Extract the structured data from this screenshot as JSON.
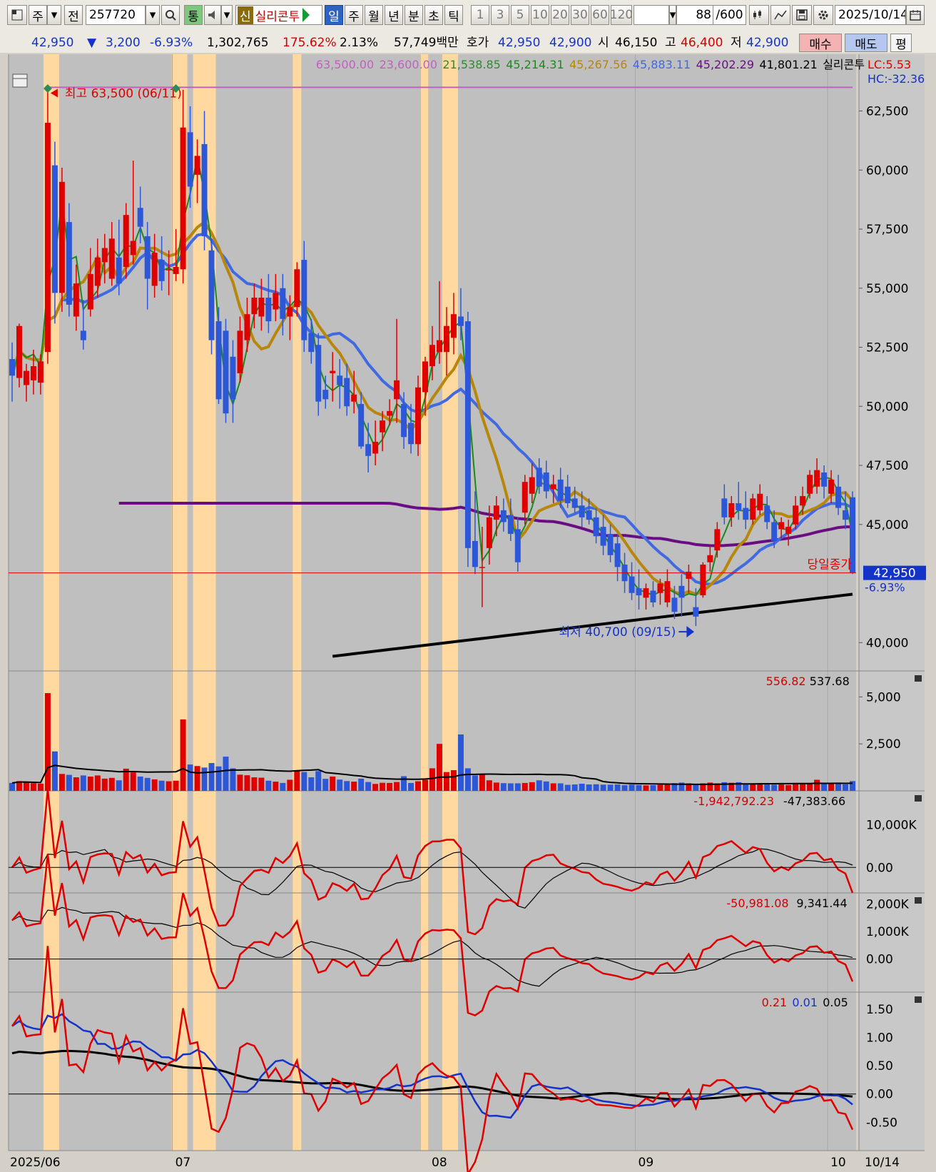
{
  "toolbar": {
    "market": "주",
    "prev": "전",
    "code": "257720",
    "tong": "통",
    "sin": "신",
    "stock_name": "실리콘투",
    "periods": [
      "일",
      "주",
      "월",
      "년",
      "분",
      "초",
      "틱"
    ],
    "intervals": [
      "1",
      "3",
      "5",
      "10",
      "20",
      "30",
      "60",
      "120"
    ],
    "count": "88",
    "count_max": "/600",
    "date": "2025/10/14"
  },
  "quote": {
    "price": "42,950",
    "change": "3,200",
    "change_pct": "-6.93%",
    "volume": "1,302,765",
    "vol_ratio": "175.62%",
    "turnover": "2.13%",
    "amount": "57,749백만",
    "hoga_label": "호가",
    "ask": "42,950",
    "bid": "42,900",
    "open_label": "시",
    "open": "46,150",
    "high_label": "고",
    "high": "46,400",
    "low_label": "저",
    "low": "42,900",
    "buy": "매수",
    "sell": "매도",
    "eval": "평"
  },
  "price_panel": {
    "legend": [
      {
        "text": "63,500.00",
        "color": "#c060c0"
      },
      {
        "text": "23,600.00",
        "color": "#c060c0"
      },
      {
        "text": "21,538.85",
        "color": "#2e8b2e"
      },
      {
        "text": "45,214.31",
        "color": "#1a8a1a"
      },
      {
        "text": "45,267.56",
        "color": "#b8860b"
      },
      {
        "text": "45,883.11",
        "color": "#4169e1"
      },
      {
        "text": "45,202.29",
        "color": "#6a0d83"
      },
      {
        "text": "41,801.21",
        "color": "#000000"
      },
      {
        "text": "실리콘투",
        "color": "#000000"
      }
    ],
    "lc": "LC:5.53",
    "hc": "HC:-32.36",
    "high_label": "최고 63,500 (06/11)",
    "low_label": "최저 40,700 (09/15)",
    "close_label": "당일종가",
    "last_price": "42,950",
    "last_pct": "-6.93%",
    "y_ticks": [
      "62,500",
      "60,000",
      "57,500",
      "55,000",
      "52,500",
      "50,000",
      "47,500",
      "45,000",
      "40,000"
    ]
  },
  "volume_panel": {
    "legend": [
      {
        "text": "556.82",
        "color": "#d40000"
      },
      {
        "text": "537.68",
        "color": "#000000"
      }
    ],
    "y_ticks": [
      "5,000",
      "2,500"
    ]
  },
  "ind1": {
    "legend": [
      {
        "text": "-1,942,792.23",
        "color": "#d40000"
      },
      {
        "text": "-47,383.66",
        "color": "#000000"
      }
    ],
    "y_ticks": [
      "10,000K",
      "0.00"
    ]
  },
  "ind2": {
    "legend": [
      {
        "text": "-50,981.08",
        "color": "#d40000"
      },
      {
        "text": "9,341.44",
        "color": "#000000"
      }
    ],
    "y_ticks": [
      "2,000K",
      "1,000K",
      "0.00"
    ]
  },
  "ind3": {
    "legend": [
      {
        "text": "0.21",
        "color": "#d40000"
      },
      {
        "text": "0.01",
        "color": "#1433c8"
      },
      {
        "text": "0.05",
        "color": "#000000"
      }
    ],
    "y_ticks": [
      "1.50",
      "1.00",
      "0.50",
      "0.00",
      "-0.50"
    ]
  },
  "x_labels": [
    "2025/06",
    "07",
    "08",
    "09",
    "10",
    "10/14"
  ],
  "candles": [
    {
      "o": 52000,
      "h": 52700,
      "l": 50200,
      "c": 51300,
      "v": 420
    },
    {
      "o": 51200,
      "h": 53500,
      "l": 50800,
      "c": 53400,
      "v": 520
    },
    {
      "o": 50900,
      "h": 51800,
      "l": 50200,
      "c": 51500,
      "v": 470
    },
    {
      "o": 51100,
      "h": 52400,
      "l": 50500,
      "c": 51700,
      "v": 410
    },
    {
      "o": 51000,
      "h": 52200,
      "l": 50500,
      "c": 51900,
      "v": 380
    },
    {
      "o": 52300,
      "h": 63500,
      "l": 51800,
      "c": 62000,
      "v": 5200
    },
    {
      "o": 60200,
      "h": 61200,
      "l": 53500,
      "c": 54800,
      "v": 2100
    },
    {
      "o": 54800,
      "h": 60100,
      "l": 54000,
      "c": 59500,
      "v": 900
    },
    {
      "o": 57800,
      "h": 58600,
      "l": 53800,
      "c": 54300,
      "v": 850
    },
    {
      "o": 53800,
      "h": 56000,
      "l": 53200,
      "c": 55200,
      "v": 720
    },
    {
      "o": 53200,
      "h": 54500,
      "l": 52400,
      "c": 52800,
      "v": 820
    },
    {
      "o": 54100,
      "h": 56700,
      "l": 53800,
      "c": 55600,
      "v": 760
    },
    {
      "o": 55100,
      "h": 57100,
      "l": 54600,
      "c": 56300,
      "v": 820
    },
    {
      "o": 56100,
      "h": 57300,
      "l": 55200,
      "c": 56700,
      "v": 650
    },
    {
      "o": 55400,
      "h": 57800,
      "l": 55100,
      "c": 57100,
      "v": 690
    },
    {
      "o": 56300,
      "h": 57900,
      "l": 54700,
      "c": 55200,
      "v": 560
    },
    {
      "o": 55900,
      "h": 58600,
      "l": 55400,
      "c": 58100,
      "v": 1180
    },
    {
      "o": 56400,
      "h": 60400,
      "l": 56000,
      "c": 57000,
      "v": 980
    },
    {
      "o": 58400,
      "h": 59300,
      "l": 56900,
      "c": 57600,
      "v": 760
    },
    {
      "o": 57200,
      "h": 57800,
      "l": 54100,
      "c": 55400,
      "v": 690
    },
    {
      "o": 55100,
      "h": 57300,
      "l": 54600,
      "c": 56500,
      "v": 610
    },
    {
      "o": 56200,
      "h": 57200,
      "l": 54900,
      "c": 55300,
      "v": 540
    },
    {
      "o": 55800,
      "h": 56600,
      "l": 54700,
      "c": 55800,
      "v": 510
    },
    {
      "o": 55600,
      "h": 57500,
      "l": 55300,
      "c": 55900,
      "v": 540
    },
    {
      "o": 55800,
      "h": 63400,
      "l": 55200,
      "c": 61800,
      "v": 3800
    },
    {
      "o": 61600,
      "h": 62700,
      "l": 58400,
      "c": 59300,
      "v": 1400
    },
    {
      "o": 59800,
      "h": 61300,
      "l": 58600,
      "c": 60600,
      "v": 1320
    },
    {
      "o": 61100,
      "h": 62500,
      "l": 56600,
      "c": 57200,
      "v": 1240
    },
    {
      "o": 56600,
      "h": 57100,
      "l": 52200,
      "c": 52800,
      "v": 1480
    },
    {
      "o": 53600,
      "h": 54200,
      "l": 50100,
      "c": 50300,
      "v": 1300
    },
    {
      "o": 53200,
      "h": 53700,
      "l": 49300,
      "c": 49700,
      "v": 1820
    },
    {
      "o": 52100,
      "h": 52800,
      "l": 49300,
      "c": 50300,
      "v": 1200
    },
    {
      "o": 51400,
      "h": 53800,
      "l": 51000,
      "c": 53200,
      "v": 860
    },
    {
      "o": 52800,
      "h": 54600,
      "l": 52300,
      "c": 53900,
      "v": 830
    },
    {
      "o": 53900,
      "h": 55200,
      "l": 53300,
      "c": 54600,
      "v": 720
    },
    {
      "o": 53800,
      "h": 55400,
      "l": 53200,
      "c": 54600,
      "v": 700
    },
    {
      "o": 54600,
      "h": 55600,
      "l": 53100,
      "c": 53600,
      "v": 540
    },
    {
      "o": 54100,
      "h": 55600,
      "l": 53600,
      "c": 54800,
      "v": 490
    },
    {
      "o": 55000,
      "h": 55600,
      "l": 53000,
      "c": 53700,
      "v": 420
    },
    {
      "o": 53800,
      "h": 54700,
      "l": 52800,
      "c": 54200,
      "v": 590
    },
    {
      "o": 54200,
      "h": 56100,
      "l": 53800,
      "c": 55800,
      "v": 1100
    },
    {
      "o": 56200,
      "h": 57000,
      "l": 52300,
      "c": 52800,
      "v": 1000
    },
    {
      "o": 53100,
      "h": 53700,
      "l": 51800,
      "c": 52300,
      "v": 720
    },
    {
      "o": 52600,
      "h": 53100,
      "l": 49600,
      "c": 50200,
      "v": 1050
    },
    {
      "o": 50700,
      "h": 51300,
      "l": 49900,
      "c": 50300,
      "v": 640
    },
    {
      "o": 51400,
      "h": 52300,
      "l": 50200,
      "c": 51500,
      "v": 760
    },
    {
      "o": 51300,
      "h": 52000,
      "l": 49900,
      "c": 50900,
      "v": 600
    },
    {
      "o": 51200,
      "h": 51800,
      "l": 49600,
      "c": 50000,
      "v": 520
    },
    {
      "o": 50200,
      "h": 51500,
      "l": 49700,
      "c": 50500,
      "v": 490
    },
    {
      "o": 50100,
      "h": 50600,
      "l": 48200,
      "c": 48300,
      "v": 650
    },
    {
      "o": 48400,
      "h": 49300,
      "l": 47200,
      "c": 47900,
      "v": 470
    },
    {
      "o": 48000,
      "h": 49400,
      "l": 47500,
      "c": 48500,
      "v": 370
    },
    {
      "o": 48900,
      "h": 49800,
      "l": 48100,
      "c": 49400,
      "v": 430
    },
    {
      "o": 49600,
      "h": 50300,
      "l": 49200,
      "c": 49800,
      "v": 420
    },
    {
      "o": 50300,
      "h": 53700,
      "l": 49300,
      "c": 51100,
      "v": 470
    },
    {
      "o": 50100,
      "h": 50600,
      "l": 48200,
      "c": 48700,
      "v": 780
    },
    {
      "o": 49300,
      "h": 50100,
      "l": 48000,
      "c": 48400,
      "v": 420
    },
    {
      "o": 48400,
      "h": 51300,
      "l": 47900,
      "c": 50800,
      "v": 510
    },
    {
      "o": 50600,
      "h": 52100,
      "l": 49600,
      "c": 51900,
      "v": 590
    },
    {
      "o": 51700,
      "h": 53400,
      "l": 51100,
      "c": 52600,
      "v": 1200
    },
    {
      "o": 52300,
      "h": 55300,
      "l": 51800,
      "c": 52800,
      "v": 2500
    },
    {
      "o": 52300,
      "h": 54200,
      "l": 51300,
      "c": 53400,
      "v": 1000
    },
    {
      "o": 52900,
      "h": 54800,
      "l": 52200,
      "c": 53900,
      "v": 1100
    },
    {
      "o": 53800,
      "h": 55000,
      "l": 52800,
      "c": 53400,
      "v": 3000
    },
    {
      "o": 53600,
      "h": 54000,
      "l": 43200,
      "c": 44000,
      "v": 1200
    },
    {
      "o": 44300,
      "h": 46400,
      "l": 42900,
      "c": 43200,
      "v": 820
    },
    {
      "o": 43200,
      "h": 44900,
      "l": 41500,
      "c": 43200,
      "v": 860
    },
    {
      "o": 44000,
      "h": 45800,
      "l": 43300,
      "c": 45300,
      "v": 560
    },
    {
      "o": 45200,
      "h": 46200,
      "l": 44500,
      "c": 45800,
      "v": 440
    },
    {
      "o": 45600,
      "h": 46100,
      "l": 44700,
      "c": 45100,
      "v": 410
    },
    {
      "o": 45400,
      "h": 46100,
      "l": 44300,
      "c": 44600,
      "v": 400
    },
    {
      "o": 44800,
      "h": 45300,
      "l": 43000,
      "c": 43400,
      "v": 400
    },
    {
      "o": 45500,
      "h": 47100,
      "l": 45000,
      "c": 46800,
      "v": 420
    },
    {
      "o": 46300,
      "h": 47600,
      "l": 45900,
      "c": 47000,
      "v": 460
    },
    {
      "o": 47400,
      "h": 47800,
      "l": 46300,
      "c": 46600,
      "v": 560
    },
    {
      "o": 47200,
      "h": 47700,
      "l": 46100,
      "c": 46400,
      "v": 500
    },
    {
      "o": 46500,
      "h": 47100,
      "l": 45900,
      "c": 46700,
      "v": 400
    },
    {
      "o": 46900,
      "h": 47400,
      "l": 45700,
      "c": 46000,
      "v": 400
    },
    {
      "o": 46600,
      "h": 47100,
      "l": 45700,
      "c": 45900,
      "v": 320
    },
    {
      "o": 46100,
      "h": 46600,
      "l": 45500,
      "c": 45700,
      "v": 340
    },
    {
      "o": 45800,
      "h": 46400,
      "l": 44900,
      "c": 45300,
      "v": 380
    },
    {
      "o": 45600,
      "h": 46100,
      "l": 45000,
      "c": 45200,
      "v": 340
    },
    {
      "o": 45300,
      "h": 45700,
      "l": 44200,
      "c": 44500,
      "v": 350
    },
    {
      "o": 44900,
      "h": 45400,
      "l": 43700,
      "c": 44100,
      "v": 330
    },
    {
      "o": 44600,
      "h": 45000,
      "l": 43400,
      "c": 43700,
      "v": 330
    },
    {
      "o": 44200,
      "h": 44600,
      "l": 42600,
      "c": 43200,
      "v": 340
    },
    {
      "o": 43300,
      "h": 43800,
      "l": 42100,
      "c": 42600,
      "v": 300
    },
    {
      "o": 42800,
      "h": 43400,
      "l": 41800,
      "c": 42100,
      "v": 330
    },
    {
      "o": 42300,
      "h": 43100,
      "l": 41400,
      "c": 42000,
      "v": 310
    },
    {
      "o": 41900,
      "h": 42500,
      "l": 41400,
      "c": 42300,
      "v": 290
    },
    {
      "o": 42200,
      "h": 42600,
      "l": 41500,
      "c": 41700,
      "v": 300
    },
    {
      "o": 42100,
      "h": 42700,
      "l": 41600,
      "c": 42500,
      "v": 320
    },
    {
      "o": 41700,
      "h": 43100,
      "l": 41500,
      "c": 42600,
      "v": 320
    },
    {
      "o": 41900,
      "h": 42400,
      "l": 41000,
      "c": 41300,
      "v": 410
    },
    {
      "o": 42400,
      "h": 42900,
      "l": 41100,
      "c": 41900,
      "v": 440
    },
    {
      "o": 42700,
      "h": 43300,
      "l": 42100,
      "c": 43000,
      "v": 400
    },
    {
      "o": 41500,
      "h": 42300,
      "l": 40700,
      "c": 41100,
      "v": 360
    },
    {
      "o": 42000,
      "h": 43400,
      "l": 41900,
      "c": 43300,
      "v": 400
    },
    {
      "o": 43400,
      "h": 44100,
      "l": 43000,
      "c": 43700,
      "v": 440
    },
    {
      "o": 43900,
      "h": 45100,
      "l": 43600,
      "c": 44800,
      "v": 400
    },
    {
      "o": 46100,
      "h": 46700,
      "l": 45000,
      "c": 45300,
      "v": 460
    },
    {
      "o": 45300,
      "h": 46200,
      "l": 44900,
      "c": 45900,
      "v": 430
    },
    {
      "o": 45900,
      "h": 46800,
      "l": 45200,
      "c": 45600,
      "v": 460
    },
    {
      "o": 45700,
      "h": 46400,
      "l": 44800,
      "c": 45200,
      "v": 400
    },
    {
      "o": 45200,
      "h": 46300,
      "l": 45000,
      "c": 46100,
      "v": 360
    },
    {
      "o": 45600,
      "h": 46700,
      "l": 45400,
      "c": 46300,
      "v": 410
    },
    {
      "o": 45800,
      "h": 46200,
      "l": 44800,
      "c": 45100,
      "v": 390
    },
    {
      "o": 45100,
      "h": 45600,
      "l": 44000,
      "c": 44300,
      "v": 330
    },
    {
      "o": 44800,
      "h": 45300,
      "l": 44400,
      "c": 45100,
      "v": 340
    },
    {
      "o": 44600,
      "h": 45200,
      "l": 44100,
      "c": 44900,
      "v": 310
    },
    {
      "o": 45000,
      "h": 46200,
      "l": 44800,
      "c": 45800,
      "v": 360
    },
    {
      "o": 45800,
      "h": 46600,
      "l": 45400,
      "c": 46200,
      "v": 370
    },
    {
      "o": 46300,
      "h": 47300,
      "l": 46100,
      "c": 47100,
      "v": 380
    },
    {
      "o": 46600,
      "h": 47800,
      "l": 46300,
      "c": 47300,
      "v": 590
    },
    {
      "o": 47200,
      "h": 47500,
      "l": 46100,
      "c": 46600,
      "v": 420
    },
    {
      "o": 46300,
      "h": 47300,
      "l": 45900,
      "c": 46900,
      "v": 390
    },
    {
      "o": 46600,
      "h": 47100,
      "l": 45400,
      "c": 45700,
      "v": 380
    },
    {
      "o": 45600,
      "h": 46400,
      "l": 44800,
      "c": 45200,
      "v": 350
    },
    {
      "o": 46150,
      "h": 46400,
      "l": 42900,
      "c": 42950,
      "v": 520
    }
  ]
}
